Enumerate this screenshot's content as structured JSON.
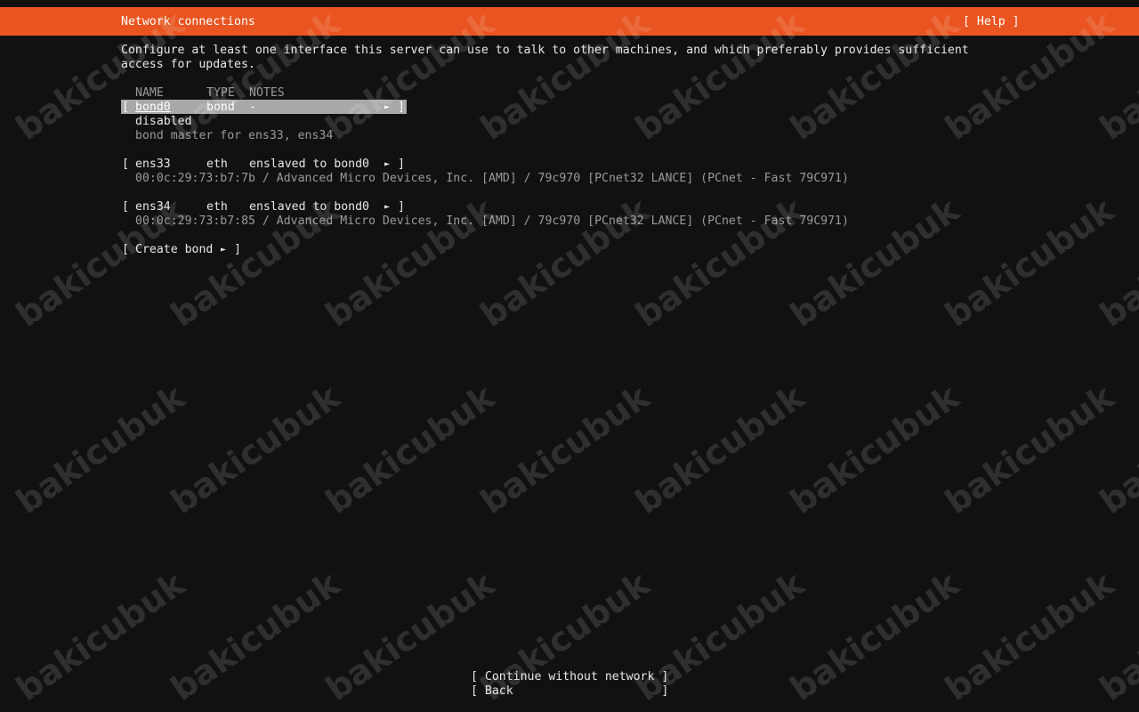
{
  "header": {
    "title": "Network connections",
    "help": "[ Help ]"
  },
  "intro": {
    "line1": "Configure at least one interface this server can use to talk to other machines, and which preferably provides sufficient",
    "line2": "access for updates."
  },
  "table": {
    "columns": {
      "name": "NAME",
      "type": "TYPE",
      "notes": "NOTES"
    },
    "rows": [
      {
        "open": "[",
        "name": "bond0",
        "type": "bond",
        "notes": "-",
        "arrow": "►",
        "close": "]",
        "status": "disabled",
        "detail": "bond master for ens33, ens34"
      },
      {
        "open": "[",
        "name": "ens33",
        "type": "eth",
        "notes": "enslaved to bond0",
        "arrow": "►",
        "close": "]",
        "detail": "00:0c:29:73:b7:7b / Advanced Micro Devices, Inc. [AMD] / 79c970 [PCnet32 LANCE] (PCnet - Fast 79C971)"
      },
      {
        "open": "[",
        "name": "ens34",
        "type": "eth",
        "notes": "enslaved to bond0",
        "arrow": "►",
        "close": "]",
        "detail": "00:0c:29:73:b7:85 / Advanced Micro Devices, Inc. [AMD] / 79c970 [PCnet32 LANCE] (PCnet - Fast 79C971)"
      }
    ]
  },
  "create_bond": {
    "open": "[",
    "label": "Create bond",
    "arrow": "►",
    "close": "]"
  },
  "footer": {
    "continue": "[ Continue without network ]",
    "back": "[ Back                     ]"
  },
  "watermark": "bakicubuk",
  "colors": {
    "header": "#e95420",
    "background": "#111111",
    "selection": "#a8a8a8"
  }
}
